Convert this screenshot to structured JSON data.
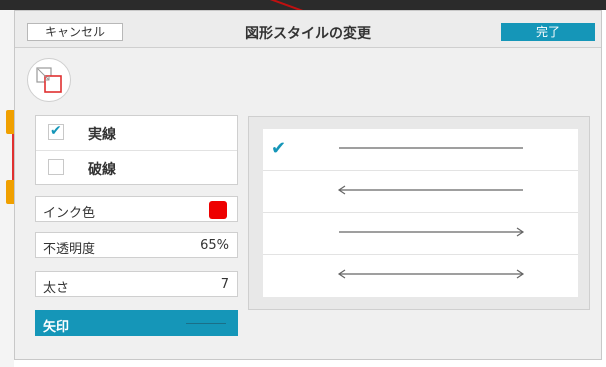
{
  "dialog": {
    "title": "図形スタイルの変更",
    "cancel_label": "キャンセル",
    "done_label": "完了"
  },
  "line_type": {
    "options": [
      {
        "label": "実線",
        "checked": true
      },
      {
        "label": "破線",
        "checked": false
      }
    ]
  },
  "ink_color": {
    "label": "インク色",
    "value": "#ee0000"
  },
  "opacity": {
    "label": "不透明度",
    "value": "65%"
  },
  "line_width": {
    "label": "太さ",
    "value": "7"
  },
  "arrow": {
    "label": "矢印"
  },
  "arrow_options": [
    {
      "name": "no-arrow",
      "selected": true,
      "check": "✔"
    },
    {
      "name": "start-arrow",
      "selected": false
    },
    {
      "name": "end-arrow",
      "selected": false
    },
    {
      "name": "both-arrows",
      "selected": false
    }
  ],
  "accent_color": "#1596b8"
}
